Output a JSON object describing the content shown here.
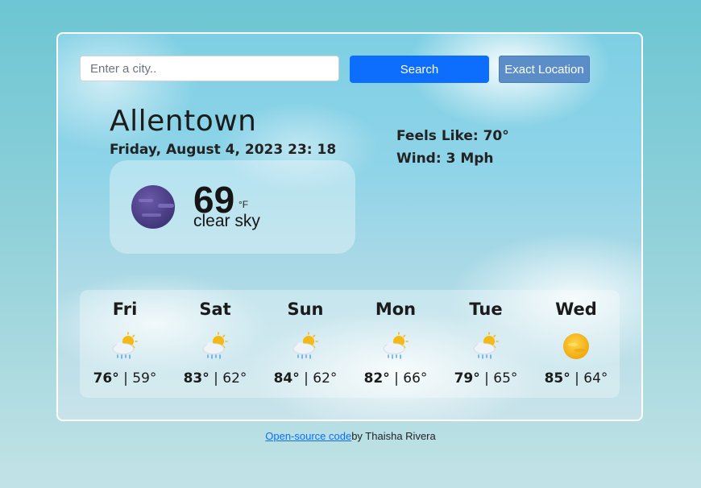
{
  "search": {
    "placeholder": "Enter a city..",
    "search_label": "Search",
    "location_label": "Exact Location"
  },
  "current": {
    "city": "Allentown",
    "datetime": "Friday, August 4, 2023 23: 18",
    "temperature": "69",
    "unit": "°F",
    "description": "clear sky",
    "feels_like": "Feels Like: 70°",
    "wind": "Wind: 3 Mph",
    "icon": "moon-night-icon"
  },
  "forecast": [
    {
      "day": "Fri",
      "high": "76°",
      "low": "59°",
      "icon": "sun-rain-cloud-icon"
    },
    {
      "day": "Sat",
      "high": "83°",
      "low": "62°",
      "icon": "sun-rain-cloud-icon"
    },
    {
      "day": "Sun",
      "high": "84°",
      "low": "62°",
      "icon": "sun-rain-cloud-icon"
    },
    {
      "day": "Mon",
      "high": "82°",
      "low": "66°",
      "icon": "sun-rain-cloud-icon"
    },
    {
      "day": "Tue",
      "high": "79°",
      "low": "65°",
      "icon": "sun-rain-cloud-icon"
    },
    {
      "day": "Wed",
      "high": "85°",
      "low": "64°",
      "icon": "sun-icon"
    }
  ],
  "footer": {
    "link_text": "Open-source code",
    "credit": "by Thaisha Rivera"
  },
  "colors": {
    "search_button": "#0d6efd",
    "location_button": "#5b8ec8",
    "page_background": "#6cc6d3"
  }
}
